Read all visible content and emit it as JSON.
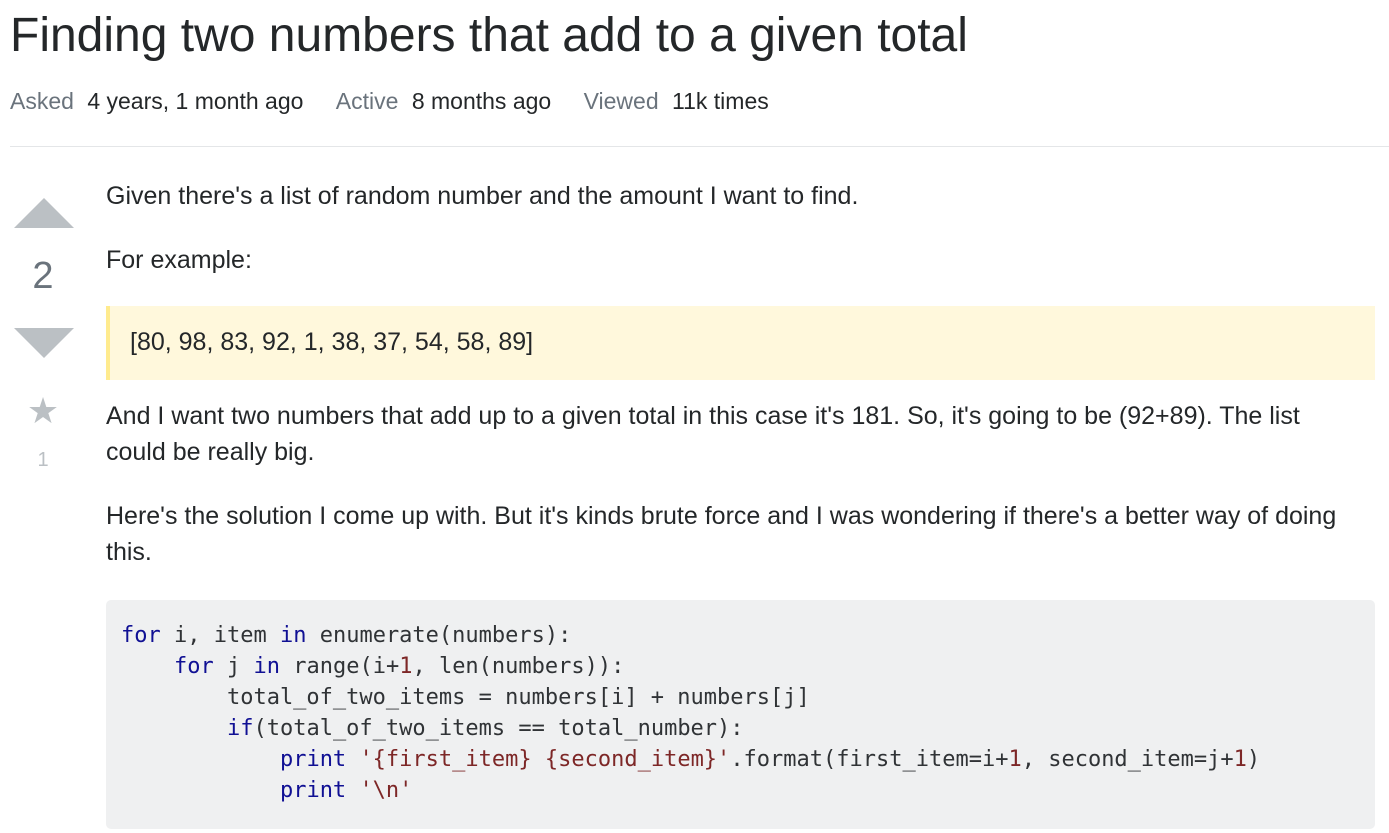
{
  "question": {
    "title": "Finding two numbers that add to a given total"
  },
  "meta": {
    "asked_label": "Asked",
    "asked_value": "4 years, 1 month ago",
    "active_label": "Active",
    "active_value": "8 months ago",
    "viewed_label": "Viewed",
    "viewed_value": "11k times"
  },
  "votes": {
    "score": "2",
    "favorites": "1",
    "up_icon": "triangle-up-icon",
    "down_icon": "triangle-down-icon",
    "favorite_icon": "star-icon",
    "star_glyph": "★"
  },
  "body": {
    "p1": "Given there's a list of random number and the amount I want to find.",
    "p2": "For example:",
    "quote": "[80, 98, 83, 92, 1, 38, 37, 54, 58, 89]",
    "p3": "And I want two numbers that add up to a given total in this case it's 181. So, it's going to be (92+89). The list could be really big.",
    "p4": "Here's the solution I come up with. But it's kinds brute force and I was wondering if there's a better way of doing this."
  },
  "code": {
    "lines": [
      [
        {
          "t": "for",
          "c": "kw"
        },
        {
          "t": " i, item ",
          "c": ""
        },
        {
          "t": "in",
          "c": "kw"
        },
        {
          "t": " enumerate(numbers):",
          "c": ""
        }
      ],
      [
        {
          "t": "    ",
          "c": ""
        },
        {
          "t": "for",
          "c": "kw"
        },
        {
          "t": " j ",
          "c": ""
        },
        {
          "t": "in",
          "c": "kw"
        },
        {
          "t": " range(i+",
          "c": ""
        },
        {
          "t": "1",
          "c": "num"
        },
        {
          "t": ", len(numbers)):",
          "c": ""
        }
      ],
      [
        {
          "t": "        total_of_two_items = numbers[i] + numbers[j]",
          "c": ""
        }
      ],
      [
        {
          "t": "        ",
          "c": ""
        },
        {
          "t": "if",
          "c": "kw"
        },
        {
          "t": "(total_of_two_items == total_number):",
          "c": ""
        }
      ],
      [
        {
          "t": "            ",
          "c": ""
        },
        {
          "t": "print",
          "c": "kw"
        },
        {
          "t": " ",
          "c": ""
        },
        {
          "t": "'{first_item} {second_item}'",
          "c": "str"
        },
        {
          "t": ".format(first_item=i+",
          "c": ""
        },
        {
          "t": "1",
          "c": "num"
        },
        {
          "t": ", second_item=j+",
          "c": ""
        },
        {
          "t": "1",
          "c": "num"
        },
        {
          "t": ")",
          "c": ""
        }
      ],
      [
        {
          "t": "            ",
          "c": ""
        },
        {
          "t": "print",
          "c": "kw"
        },
        {
          "t": " ",
          "c": ""
        },
        {
          "t": "'\\n'",
          "c": "str"
        }
      ]
    ]
  },
  "colors": {
    "text": "#242729",
    "muted": "#6a737c",
    "vote_arrow": "#bbc0c4",
    "quote_bg": "#fff8dc",
    "quote_border": "#ffeb8e",
    "code_bg": "#eff0f1",
    "code_keyword": "#101094",
    "code_literal": "#7d2727"
  }
}
